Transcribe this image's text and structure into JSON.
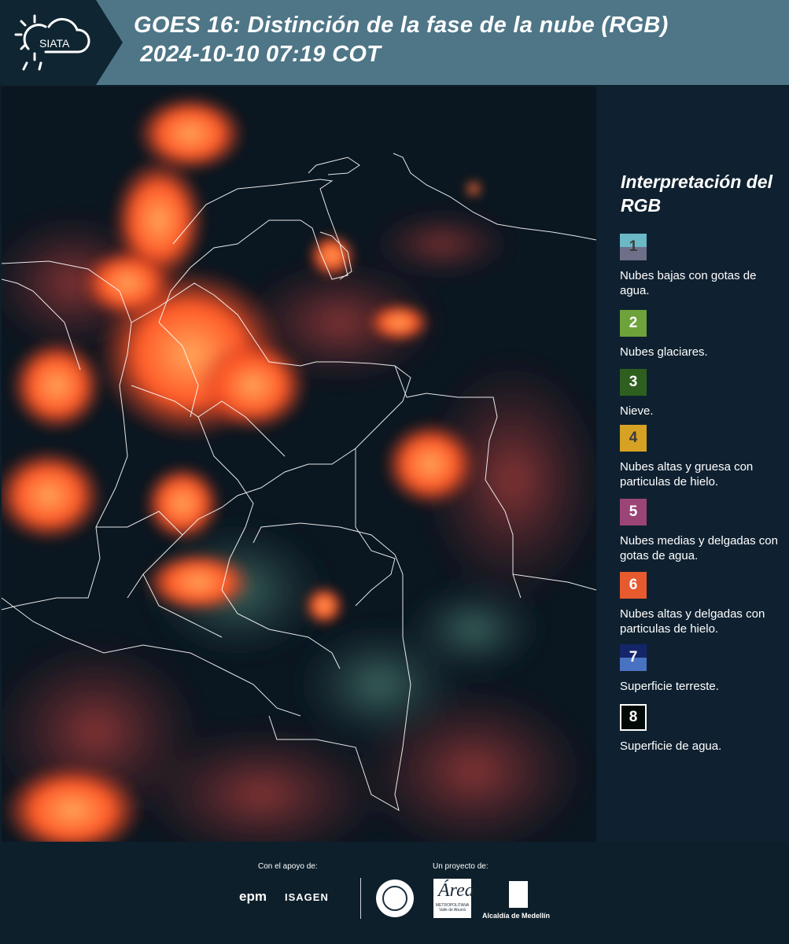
{
  "header": {
    "logo_text": "SIATA",
    "title": "GOES 16: Distinción de la fase de la nube (RGB)\n 2024-10-10 07:19 COT"
  },
  "legend": {
    "title": "Interpretación del RGB",
    "items": [
      {
        "number": "1",
        "label": "Nubes bajas con gotas de agua.",
        "colors": [
          "#6bb8c6",
          "#6e6f89"
        ],
        "text_color": "#3b3b3b"
      },
      {
        "number": "2",
        "label": "Nubes glaciares.",
        "colors": [
          "#6ea23a"
        ],
        "text_color": "#ffffff"
      },
      {
        "number": "3",
        "label": "Nieve.",
        "colors": [
          "#2f5f1f"
        ],
        "text_color": "#ffffff"
      },
      {
        "number": "4",
        "label": "Nubes altas y gruesa con particulas de hielo.",
        "colors": [
          "#d7a224"
        ],
        "text_color": "#3b3b3b"
      },
      {
        "number": "5",
        "label": "Nubes medias y delgadas con gotas de agua.",
        "colors": [
          "#9a4575"
        ],
        "text_color": "#ffffff"
      },
      {
        "number": "6",
        "label": "Nubes altas y delgadas con particulas de hielo.",
        "colors": [
          "#e65a2e"
        ],
        "text_color": "#ffffff"
      },
      {
        "number": "7",
        "label": "Superficie terreste.",
        "colors": [
          "#15256a",
          "#4a72c2"
        ],
        "text_color": "#ffffff"
      },
      {
        "number": "8",
        "label": "Superficie de agua.",
        "colors": [
          "#020a08"
        ],
        "text_color": "#ffffff",
        "border": "#ffffff"
      }
    ]
  },
  "footer": {
    "support_label": "Con el apoyo de:",
    "project_label": "Un proyecto de:",
    "sponsor_1": "epm",
    "sponsor_2": "ISAGEN",
    "area_logo_text": "Área",
    "area_logo_small": "METROPOLITANA Valle de Aburrá",
    "alcaldia_label": "Alcaldía de Medellín"
  }
}
